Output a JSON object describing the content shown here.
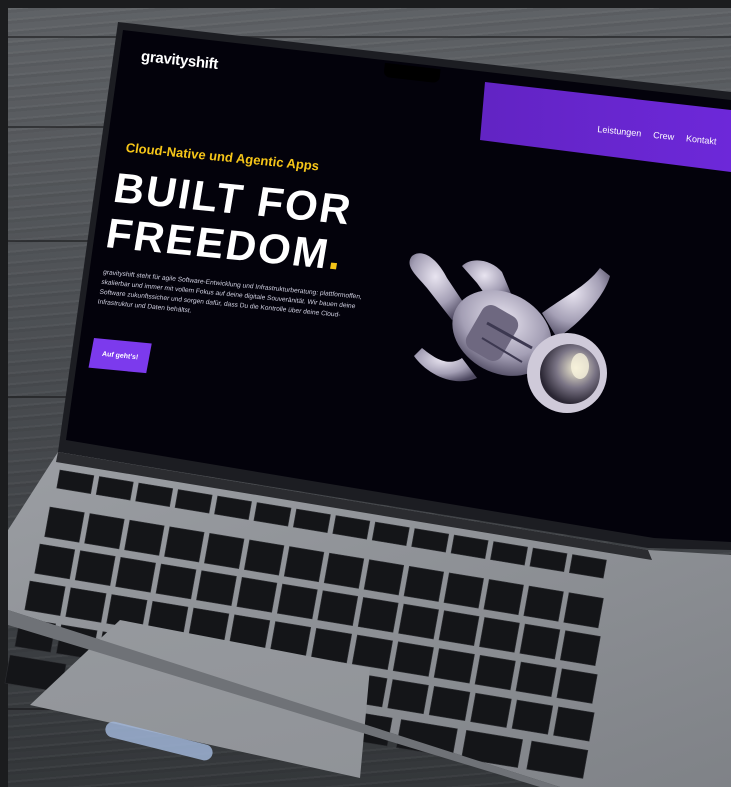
{
  "site": {
    "logo": "gravityshift",
    "nav": [
      "Leistungen",
      "Crew",
      "Kontakt"
    ],
    "tagline": "Cloud-Native und Agentic Apps",
    "headline_line1": "BUILT FOR",
    "headline_line2": "FREEDOM",
    "headline_dot": ".",
    "body": "gravityshift steht für agile Software-Entwicklung und Infrastrukturberatung: plattformoffen, skalierbar und immer mit vollem Fokus auf deine digitale Souveränität. Wir bauen deine Software zukunftssicher und sorgen dafür, dass Du die Kontrolle über deine Cloud-Infrastruktur und Daten behältst.",
    "cta": "Auf geht's!"
  },
  "colors": {
    "screen_bg": "#03020b",
    "accent_yellow": "#f5c518",
    "accent_purple": "#7c3aed",
    "nav_gradient": "#6d28d9"
  },
  "icons": [
    "astronaut-illustration",
    "keyboard",
    "trackpad"
  ]
}
